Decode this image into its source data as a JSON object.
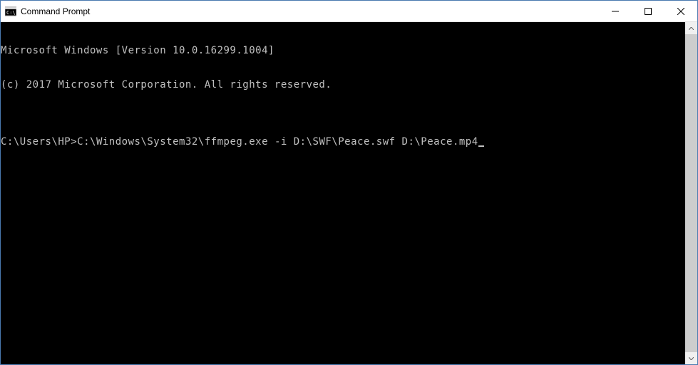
{
  "window": {
    "title": "Command Prompt"
  },
  "terminal": {
    "line1": "Microsoft Windows [Version 10.0.16299.1004]",
    "line2": "(c) 2017 Microsoft Corporation. All rights reserved.",
    "blank": "",
    "prompt": "C:\\Users\\HP>",
    "command": "C:\\Windows\\System32\\ffmpeg.exe -i D:\\SWF\\Peace.swf D:\\Peace.mp4"
  }
}
